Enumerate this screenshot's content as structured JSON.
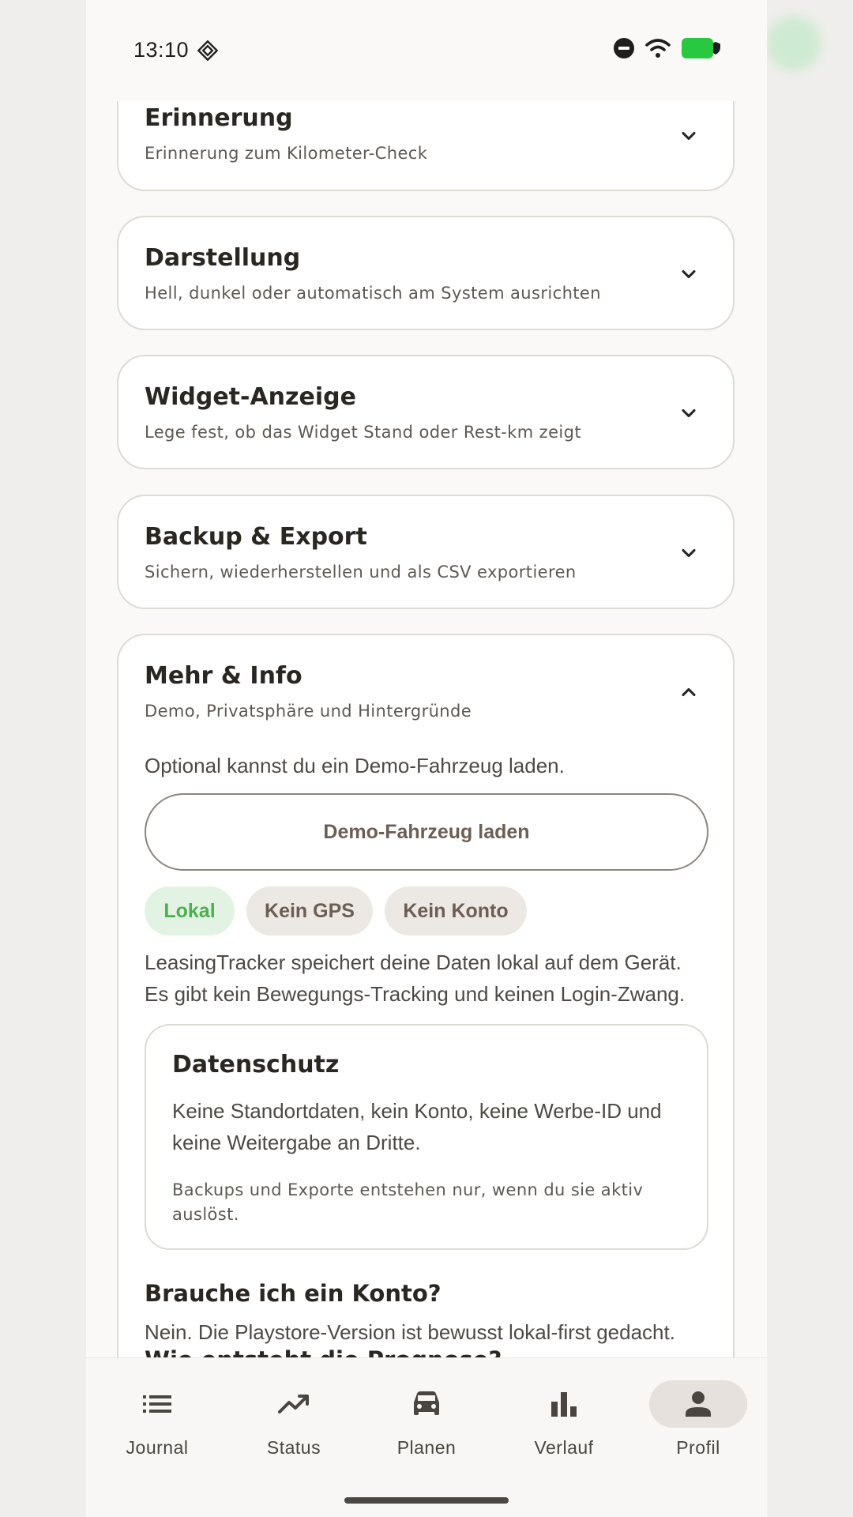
{
  "status_bar": {
    "time": "13:10",
    "icons": [
      "nfc-icon",
      "do-not-disturb-icon",
      "wifi-icon",
      "battery-icon"
    ]
  },
  "cards": {
    "erinnerung": {
      "title": "Erinnerung",
      "subtitle": "Erinnerung zum Kilometer-Check"
    },
    "darstellung": {
      "title": "Darstellung",
      "subtitle": "Hell, dunkel oder automatisch am System ausrichten"
    },
    "widget": {
      "title": "Widget-Anzeige",
      "subtitle": "Lege fest, ob das Widget Stand oder Rest-km zeigt"
    },
    "backup": {
      "title": "Backup & Export",
      "subtitle": "Sichern, wiederherstellen und als CSV exportieren"
    },
    "mehr": {
      "title": "Mehr & Info",
      "subtitle": "Demo, Privatsphäre und Hintergründe",
      "demo_hint": "Optional kannst du ein Demo-Fahrzeug laden.",
      "demo_button": "Demo-Fahrzeug laden",
      "chips": [
        "Lokal",
        "Kein GPS",
        "Kein Konto"
      ],
      "info_line1": "LeasingTracker speichert deine Daten lokal auf dem Gerät.",
      "info_line2": "Es gibt kein Bewegungs-Tracking und keinen Login-Zwang.",
      "datenschutz": {
        "title": "Datenschutz",
        "text_line1": "Keine Standortdaten, kein Konto, keine Werbe-ID und",
        "text_line2": "keine Weitergabe an Dritte.",
        "note_line1": "Backups und Exporte entstehen nur, wenn du sie aktiv",
        "note_line2": "auslöst."
      },
      "faq": [
        {
          "question": "Brauche ich ein Konto?",
          "answer": "Nein. Die Playstore-Version ist bewusst lokal-first gedacht."
        },
        {
          "question": "Wie entsteht die Prognose?"
        }
      ]
    }
  },
  "bottom_nav": {
    "items": [
      {
        "label": "Journal",
        "icon": "list-icon"
      },
      {
        "label": "Status",
        "icon": "trending-up-icon"
      },
      {
        "label": "Planen",
        "icon": "car-icon"
      },
      {
        "label": "Verlauf",
        "icon": "bar-chart-icon"
      },
      {
        "label": "Profil",
        "icon": "person-icon",
        "active": true
      }
    ]
  },
  "colors": {
    "accent_green": "#4caf50",
    "chip_grey_text": "#6d5e53",
    "active_nav_bg": "#e6e1dc"
  }
}
